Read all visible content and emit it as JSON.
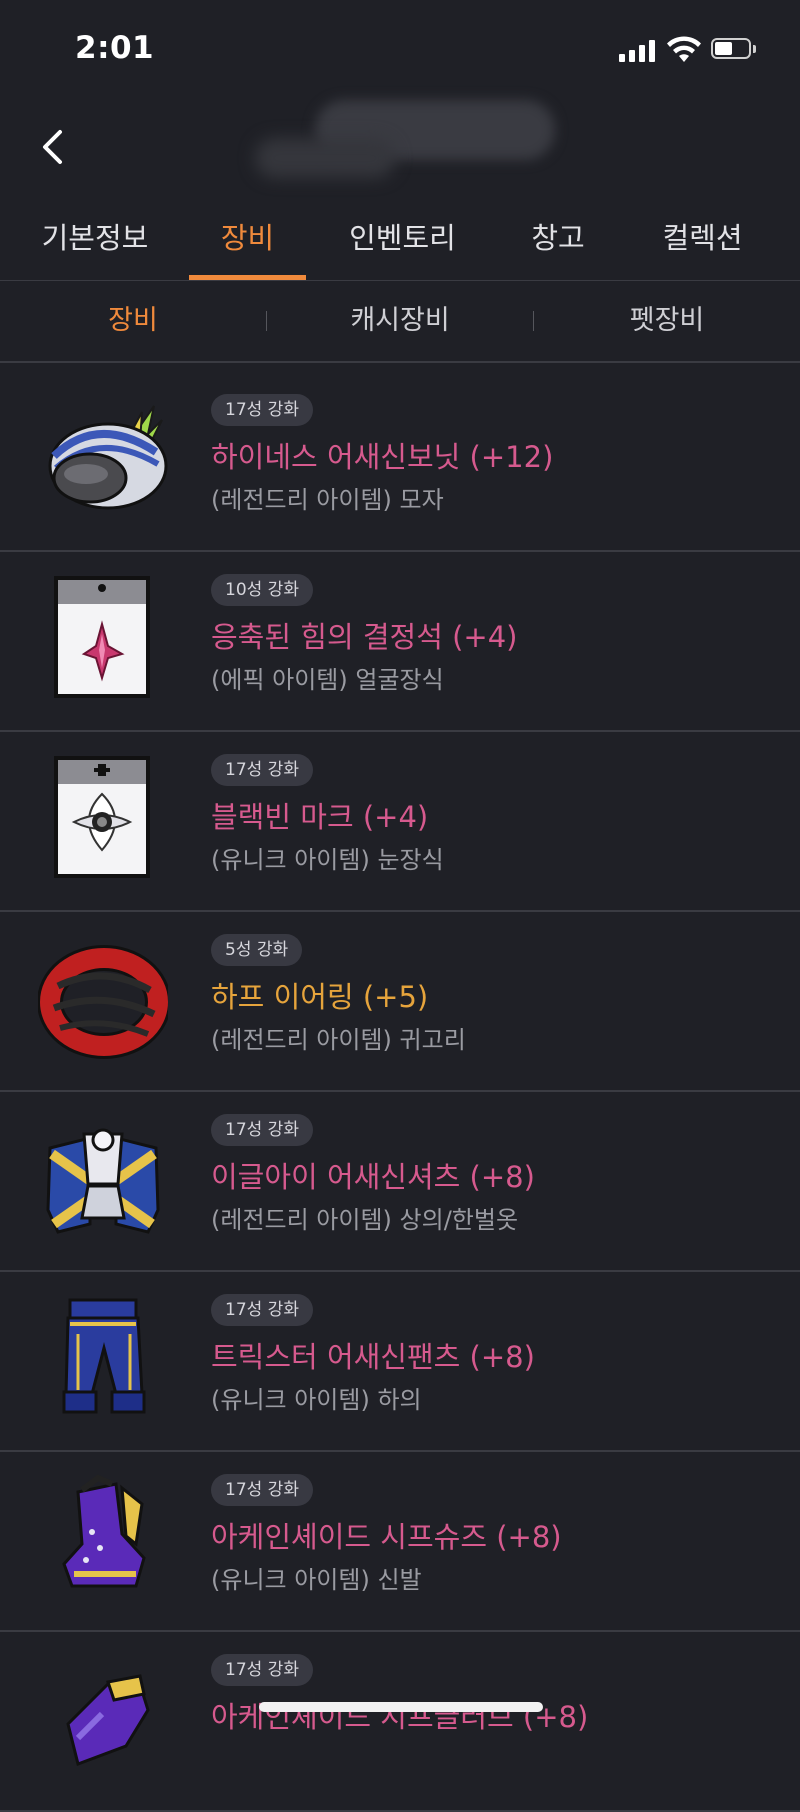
{
  "status": {
    "time": "2:01"
  },
  "main_tabs": [
    {
      "label": "기본정보"
    },
    {
      "label": "장비"
    },
    {
      "label": "인벤토리"
    },
    {
      "label": "창고"
    },
    {
      "label": "컬렉션"
    }
  ],
  "active_main_tab": "장비",
  "sub_tabs": [
    {
      "label": "장비"
    },
    {
      "label": "캐시장비"
    },
    {
      "label": "펫장비"
    }
  ],
  "active_sub_tab": "장비",
  "items": [
    {
      "stars": "17성 강화",
      "name": "하이네스 어새신보닛 (+12)",
      "info": "(레전드리 아이템) 모자",
      "icon": "hat-icon"
    },
    {
      "stars": "10성 강화",
      "name": "응축된 힘의 결정석 (+4)",
      "info": "(에픽 아이템) 얼굴장식",
      "icon": "face-accessory-icon"
    },
    {
      "stars": "17성 강화",
      "name": "블랙빈 마크 (+4)",
      "info": "(유니크 아이템) 눈장식",
      "icon": "eye-accessory-icon"
    },
    {
      "stars": "5성 강화",
      "name": "하프 이어링 (+5)",
      "info": "(레전드리 아이템) 귀고리",
      "icon": "earring-icon"
    },
    {
      "stars": "17성 강화",
      "name": "이글아이 어새신셔츠 (+8)",
      "info": "(레전드리 아이템) 상의/한벌옷",
      "icon": "top-armor-icon"
    },
    {
      "stars": "17성 강화",
      "name": "트릭스터 어새신팬츠 (+8)",
      "info": "(유니크 아이템) 하의",
      "icon": "pants-icon"
    },
    {
      "stars": "17성 강화",
      "name": "아케인셰이드 시프슈즈 (+8)",
      "info": "(유니크 아이템) 신발",
      "icon": "shoes-icon"
    },
    {
      "stars": "17성 강화",
      "name": "아케인셰이드 시프글러브 (+8)",
      "info": "",
      "icon": "gloves-icon"
    }
  ],
  "colors": {
    "accent": "#f08a3c",
    "item_name_pink": "#d65a8e",
    "item_name_gold": "#e6a43c",
    "background": "#1f2026"
  }
}
